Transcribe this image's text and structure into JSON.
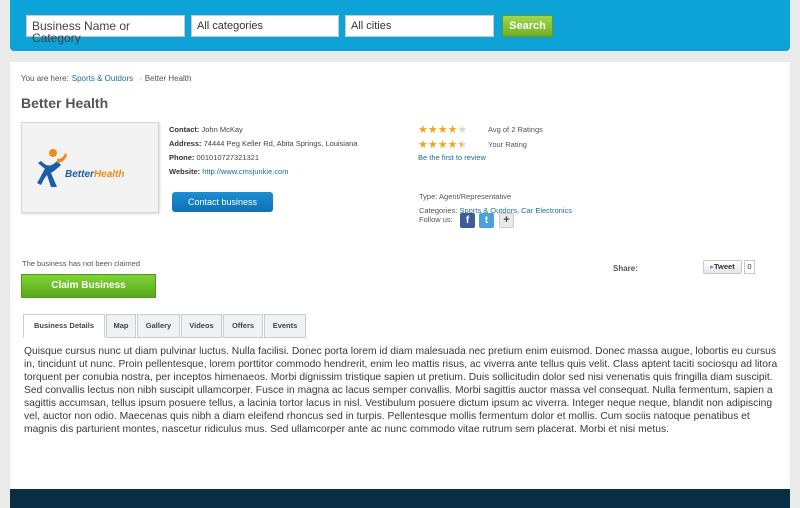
{
  "search": {
    "keyword": "Business Name or Category",
    "category": "All categories",
    "city": "All cities",
    "button": "Search"
  },
  "breadcrumb": {
    "prefix": "You are here:",
    "parent": "Sports & Outdors",
    "current": "Better Health"
  },
  "business": {
    "name": "Better Health",
    "logo_text_1": "Better",
    "logo_text_2": "Health",
    "contact_label": "Contact:",
    "contact_value": "John McKay",
    "address_label": "Address:",
    "address_value": "74444 Peg Keller Rd, Abita Springs, Louisiana",
    "phone_label": "Phone:",
    "phone_value": "001010727321321",
    "website_label": "Website:",
    "website_value": "http://www.cmsjunkie.com",
    "contact_button": "Contact business"
  },
  "ratings": {
    "avg_text": "Avg of 2 Ratings",
    "avg_stars": 4,
    "your_text": "Your Rating",
    "your_stars": 4.5,
    "first_review": "Be the first to review"
  },
  "meta": {
    "type_label": "Type:",
    "type_value": "Agent/Representative",
    "categories_label": "Categories:",
    "categories_value": "Sports & Outdors, Car Electronics",
    "follow_label": "Follow us:",
    "icons": [
      "facebook-icon",
      "twitter-icon",
      "google-plus-icon"
    ]
  },
  "claim": {
    "note": "The business has not been claimed",
    "button": "Claim Business"
  },
  "share": {
    "label": "Share:",
    "tweet": "Tweet",
    "count": "0"
  },
  "tabs": [
    "Business Details",
    "Map",
    "Gallery",
    "Videos",
    "Offers",
    "Events"
  ],
  "description": "Quisque cursus nunc ut diam pulvinar luctus. Nulla facilisi. Donec porta lorem id diam malesuada nec pretium enim euismod. Donec massa augue, lobortis eu cursus in, tincidunt ut nunc. Proin pellentesque, lorem porttitor commodo hendrerit, enim leo mattis risus, ac viverra ante tellus quis velit. Class aptent taciti sociosqu ad litora torquent per conubia nostra, per inceptos himenaeos. Morbi dignissim tristique sapien ut pretium. Duis sollicitudin dolor sed nisi venenatis quis fringilla diam suscipit. Sed convallis lectus non nibh suscipit ullamcorper. Fusce in magna ac lacus semper convallis. Morbi sagittis auctor massa vel consequat. Nulla fermentum, sapien a sagittis accumsan, tellus ipsum posuere tellus, a lacinia tortor lacus in nisl. Vestibulum posuere dictum ipsum ac viverra. Integer neque neque, blandit non adipiscing vel, auctor non odio. Maecenas quis nibh a diam eleifend rhoncus sed in turpis. Pellentesque mollis fermentum dolor et mollis. Cum sociis natoque penatibus et magnis dis parturient montes, nascetur ridiculus mus. Sed ullamcorper ante ac nunc commodo vitae rutrum sem placerat. Morbi et nisi metus.",
  "colors": {
    "header_bg": "#0ea3d6",
    "footer_bg": "#0a2f45",
    "link": "#1a6c9c",
    "claim_green": "#6cbf2a",
    "contact_blue": "#1581c6"
  }
}
